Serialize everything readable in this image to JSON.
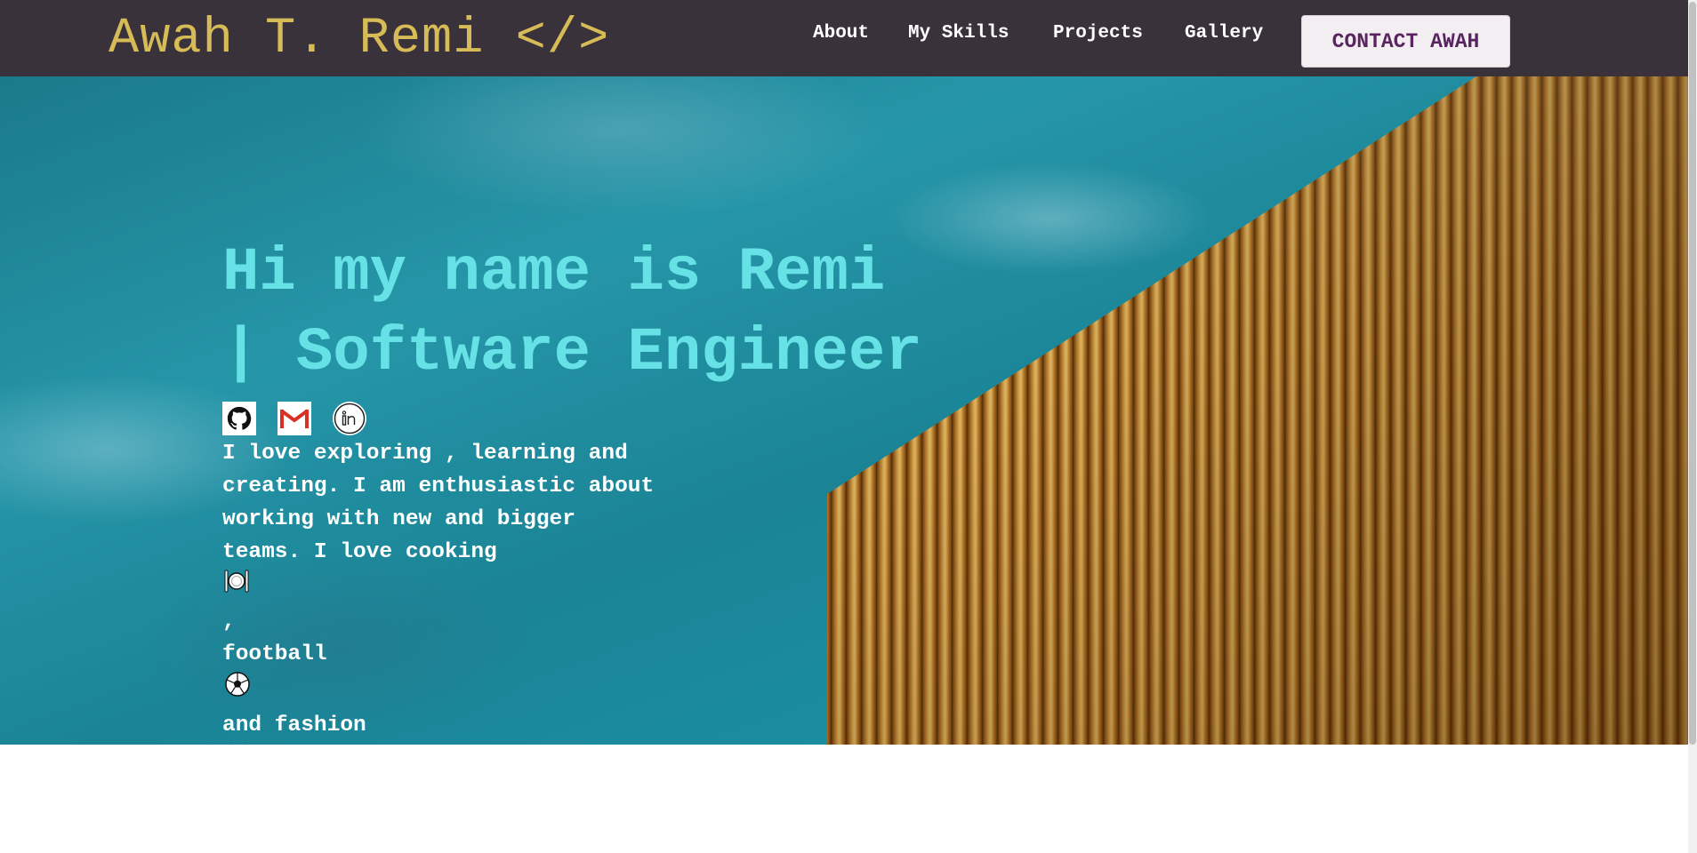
{
  "header": {
    "brand": "Awah T. Remi </>",
    "nav": [
      "About",
      "My Skills",
      "Projects",
      "Gallery"
    ],
    "contact_button": "CONTACT AWAH"
  },
  "hero": {
    "headline_line1": "Hi my name is Remi",
    "headline_line2": "| Software Engineer",
    "socials": [
      {
        "icon": "github-icon"
      },
      {
        "icon": "gmail-icon"
      },
      {
        "icon": "linkedin-icon"
      }
    ],
    "bio_lines": [
      "I love exploring , learning and",
      "creating. I am enthusiastic about",
      "working with new and bigger",
      "teams. I love cooking",
      "football",
      " and fashion"
    ],
    "bio_line4_suffix": ","
  },
  "colors": {
    "navbar": "#3a323b",
    "brand": "#d6bb56",
    "headline": "#66e2e6",
    "contact_text": "#5a2460"
  }
}
